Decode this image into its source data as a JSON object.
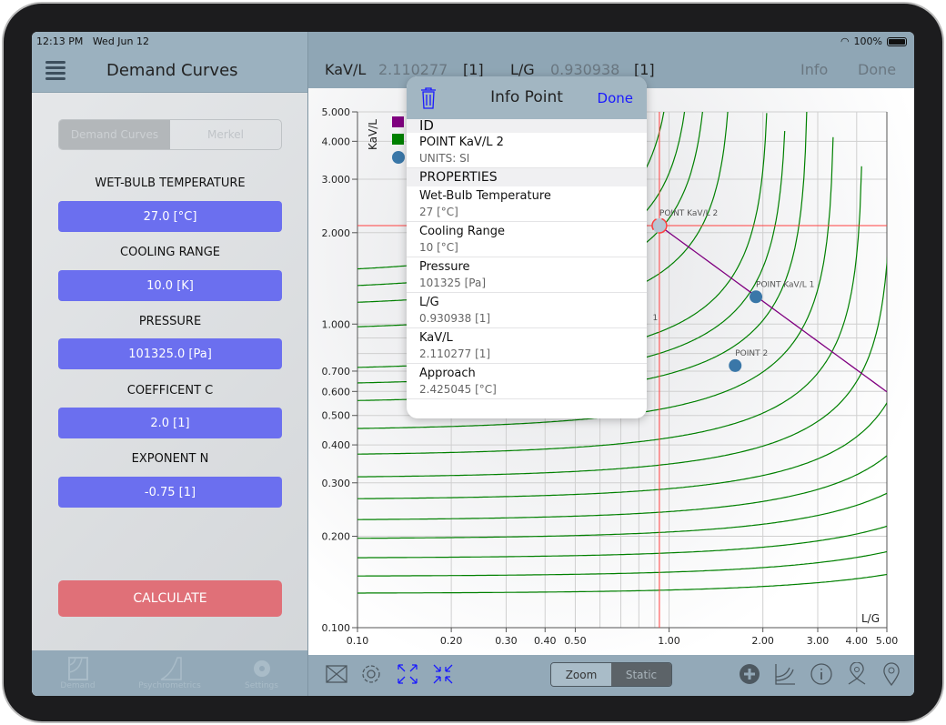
{
  "status": {
    "time": "12:13 PM",
    "date": "Wed Jun 12",
    "battery": "100%"
  },
  "sidebar": {
    "title": "Demand Curves",
    "segments": [
      "Demand Curves",
      "Merkel"
    ],
    "selected_segment": "Demand Curves",
    "fields": [
      {
        "label": "WET-BULB TEMPERATURE",
        "value": "27.0  [°C]"
      },
      {
        "label": "COOLING RANGE",
        "value": "10.0  [K]"
      },
      {
        "label": "PRESSURE",
        "value": "101325.0  [Pa]"
      },
      {
        "label": "COEFFICENT C",
        "value": "2.0  [1]"
      },
      {
        "label": "EXPONENT N",
        "value": "-0.75  [1]"
      }
    ],
    "calculate": "CALCULATE",
    "tabs": [
      {
        "label": "Demand",
        "icon": "demand-chart-icon"
      },
      {
        "label": "Psychrometrics",
        "icon": "psychrometric-icon"
      },
      {
        "label": "Settings",
        "icon": "gear-icon"
      }
    ]
  },
  "header": {
    "kavl_label": "KaV/L",
    "kavl_value": "2.110277",
    "kavl_unit": "[1]",
    "lg_label": "L/G",
    "lg_value": "0.930938",
    "lg_unit": "[1]",
    "info": "Info",
    "done": "Done"
  },
  "popup": {
    "title": "Info Point",
    "done": "Done",
    "id_header": "ID",
    "name": "POINT KaV/L 2",
    "units": "UNITS: SI",
    "props_header": "PROPERTIES",
    "properties": [
      {
        "k": "Wet-Bulb Temperature",
        "v": "27 [°C]"
      },
      {
        "k": "Cooling Range",
        "v": "10 [°C]"
      },
      {
        "k": "Pressure",
        "v": "101325 [Pa]"
      },
      {
        "k": "L/G",
        "v": "0.930938 [1]"
      },
      {
        "k": "KaV/L",
        "v": "2.110277 [1]"
      },
      {
        "k": "Approach",
        "v": "2.425045 [°C]"
      }
    ]
  },
  "toolbar": {
    "zoom": "Zoom",
    "static": "Static",
    "selected": "Static"
  },
  "colors": {
    "accent": "#6b6fef",
    "calculate": "#e07078",
    "demand_curve": "#008000",
    "operating_line": "#800080",
    "crosshair": "#ff4040",
    "point": "#3a77a8"
  },
  "chart_data": {
    "type": "line",
    "xscale": "log",
    "yscale": "log",
    "xlabel": "L/G",
    "ylabel": "KaV/L",
    "xlim": [
      0.1,
      5
    ],
    "ylim": [
      0.1,
      5
    ],
    "grid": true,
    "xticks": [
      "0.10",
      "0.20",
      "0.30",
      "0.40",
      "0.50",
      "1.00",
      "2.00",
      "3.00",
      "4.00",
      "5.00"
    ],
    "yticks": [
      "0.100",
      "0.200",
      "0.300",
      "0.400",
      "0.500",
      "0.600",
      "0.700",
      "1.000",
      "2.000",
      "3.000",
      "4.000",
      "5.000"
    ],
    "demand_curves": [
      {
        "kavl_at_lg_0_1": 0.13,
        "lg_limit": 20
      },
      {
        "kavl_at_lg_0_1": 0.148,
        "lg_limit": 16
      },
      {
        "kavl_at_lg_0_1": 0.17,
        "lg_limit": 13
      },
      {
        "kavl_at_lg_0_1": 0.197,
        "lg_limit": 10
      },
      {
        "kavl_at_lg_0_1": 0.227,
        "lg_limit": 8
      },
      {
        "kavl_at_lg_0_1": 0.266,
        "lg_limit": 6.5
      },
      {
        "kavl_at_lg_0_1": 0.314,
        "lg_limit": 5.2
      },
      {
        "kavl_at_lg_0_1": 0.373,
        "lg_limit": 4.2
      },
      {
        "kavl_at_lg_0_1": 0.453,
        "lg_limit": 3.4
      },
      {
        "kavl_at_lg_0_1": 0.56,
        "lg_limit": 2.8
      },
      {
        "kavl_at_lg_0_1": 0.64,
        "lg_limit": 2.4
      },
      {
        "kavl_at_lg_0_1": 0.72,
        "lg_limit": 2.1
      },
      {
        "kavl_at_lg_0_1": 0.98,
        "lg_limit": 1.6
      },
      {
        "kavl_at_lg_0_1": 1.18,
        "lg_limit": 1.35
      },
      {
        "kavl_at_lg_0_1": 1.34,
        "lg_limit": 1.2
      },
      {
        "kavl_at_lg_0_1": 1.52,
        "lg_limit": 1.05
      }
    ],
    "operating_line": {
      "C": 2.0,
      "N": -0.75,
      "lg_range": [
        0.9,
        5
      ]
    },
    "crosshair": {
      "lg": 0.930938,
      "kavl": 2.110277
    },
    "points": [
      {
        "label": "POINT KaV/L 2",
        "lg": 0.930938,
        "kavl": 2.110277,
        "selected": true
      },
      {
        "label": "POINT KaV/L 1",
        "lg": 1.9,
        "kavl": 1.23
      },
      {
        "label": "POINT 2",
        "lg": 1.63,
        "kavl": 0.73
      }
    ],
    "hidden_label_fragment": "1"
  }
}
